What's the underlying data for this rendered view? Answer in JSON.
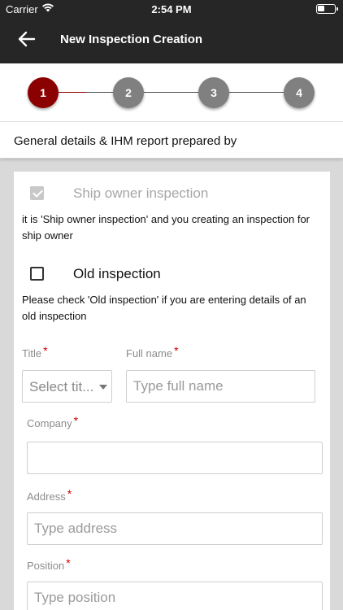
{
  "status_bar": {
    "carrier": "Carrier",
    "time": "2:54 PM",
    "battery_level": 0.4
  },
  "header": {
    "title": "New Inspection Creation",
    "back_icon": "arrow-left-icon"
  },
  "stepper": {
    "steps": [
      "1",
      "2",
      "3",
      "4"
    ],
    "active_step": 1
  },
  "section": {
    "title": "General details & IHM report prepared by"
  },
  "form": {
    "ship_owner": {
      "label": "Ship owner inspection",
      "checked": true,
      "disabled": true,
      "help": "it is 'Ship owner inspection' and you creating an inspection for ship owner"
    },
    "old_inspection": {
      "label": "Old inspection",
      "checked": false,
      "help": "Please check 'Old inspection' if you are entering details of an old inspection"
    },
    "title_field": {
      "label": "Title",
      "required_mark": "*",
      "selected": "Select tit..."
    },
    "full_name": {
      "label": "Full name",
      "required_mark": "*",
      "placeholder": "Type full name",
      "value": ""
    },
    "company": {
      "label": "Company",
      "required_mark": "*",
      "placeholder": "",
      "value": ""
    },
    "address": {
      "label": "Address",
      "required_mark": "*",
      "placeholder": "Type address",
      "value": ""
    },
    "position": {
      "label": "Position",
      "required_mark": "*",
      "placeholder": "Type position",
      "value": ""
    }
  },
  "colors": {
    "topbar": "#262626",
    "accent": "#8b0000",
    "step_inactive": "#808080",
    "required": "#d00000"
  }
}
